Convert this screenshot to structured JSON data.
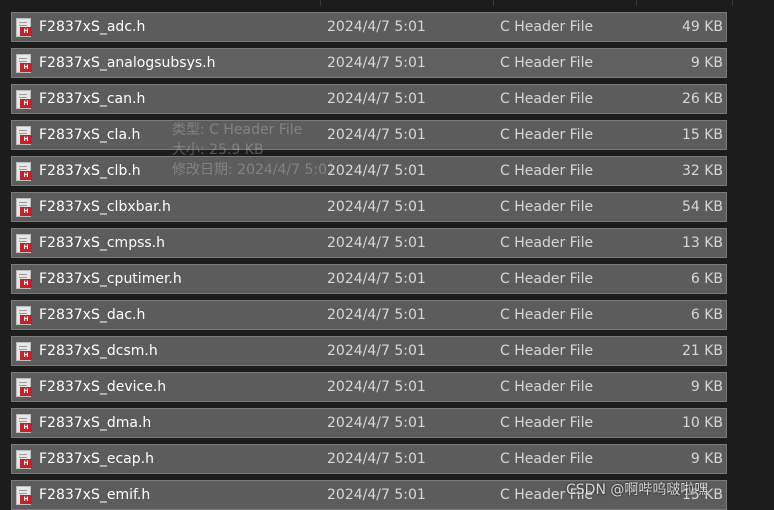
{
  "files": [
    {
      "name": "F2837xS_adc.h",
      "date": "2024/4/7 5:01",
      "type": "C Header File",
      "size": "49 KB"
    },
    {
      "name": "F2837xS_analogsubsys.h",
      "date": "2024/4/7 5:01",
      "type": "C Header File",
      "size": "9 KB"
    },
    {
      "name": "F2837xS_can.h",
      "date": "2024/4/7 5:01",
      "type": "C Header File",
      "size": "26 KB"
    },
    {
      "name": "F2837xS_cla.h",
      "date": "2024/4/7 5:01",
      "type": "C Header File",
      "size": "15 KB"
    },
    {
      "name": "F2837xS_clb.h",
      "date": "2024/4/7 5:01",
      "type": "C Header File",
      "size": "32 KB"
    },
    {
      "name": "F2837xS_clbxbar.h",
      "date": "2024/4/7 5:01",
      "type": "C Header File",
      "size": "54 KB"
    },
    {
      "name": "F2837xS_cmpss.h",
      "date": "2024/4/7 5:01",
      "type": "C Header File",
      "size": "13 KB"
    },
    {
      "name": "F2837xS_cputimer.h",
      "date": "2024/4/7 5:01",
      "type": "C Header File",
      "size": "6 KB"
    },
    {
      "name": "F2837xS_dac.h",
      "date": "2024/4/7 5:01",
      "type": "C Header File",
      "size": "6 KB"
    },
    {
      "name": "F2837xS_dcsm.h",
      "date": "2024/4/7 5:01",
      "type": "C Header File",
      "size": "21 KB"
    },
    {
      "name": "F2837xS_device.h",
      "date": "2024/4/7 5:01",
      "type": "C Header File",
      "size": "9 KB"
    },
    {
      "name": "F2837xS_dma.h",
      "date": "2024/4/7 5:01",
      "type": "C Header File",
      "size": "10 KB"
    },
    {
      "name": "F2837xS_ecap.h",
      "date": "2024/4/7 5:01",
      "type": "C Header File",
      "size": "9 KB"
    },
    {
      "name": "F2837xS_emif.h",
      "date": "2024/4/7 5:01",
      "type": "C Header File",
      "size": "15 KB"
    }
  ],
  "tooltip": {
    "type_line": "类型: C Header File",
    "size_line": "大小: 25.9 KB",
    "date_line": "修改日期: 2024/4/7 5:01"
  },
  "watermark": "CSDN @啊哔呜啵啦嘿",
  "icon": {
    "name": "c-header-file-icon",
    "badge": "H"
  },
  "colors": {
    "row_bg": "#5c5c5c",
    "background": "#1c1c1c",
    "icon_badge": "#c8202a"
  }
}
